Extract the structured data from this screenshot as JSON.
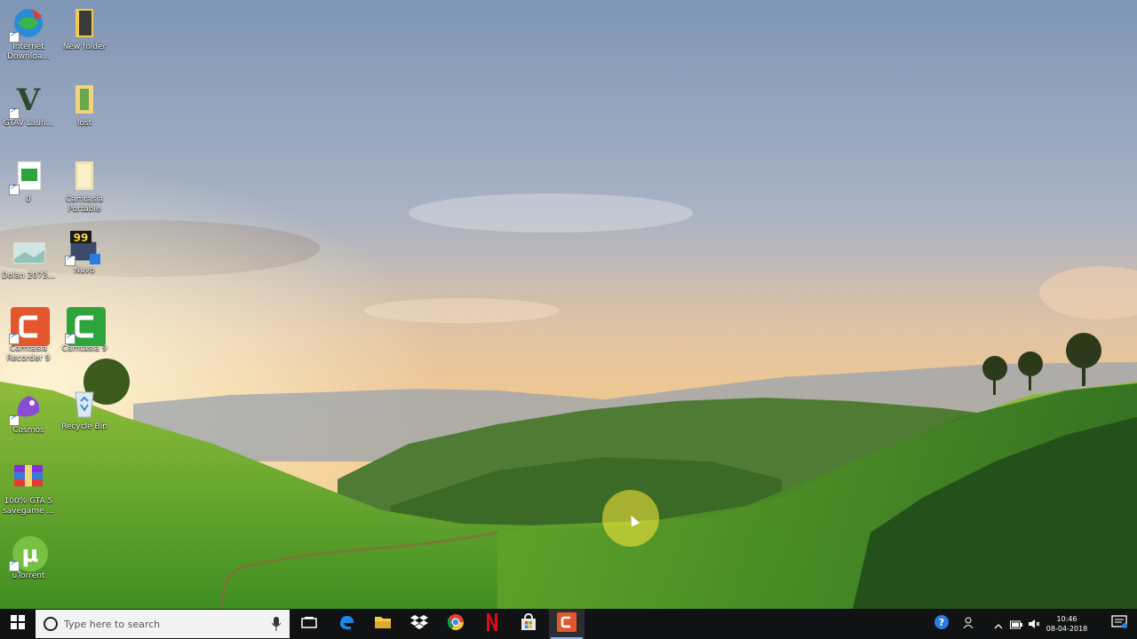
{
  "desktop": {
    "icons": [
      {
        "label": "Internet Downloa...",
        "icon": "idm-globe-icon"
      },
      {
        "label": "New folder",
        "icon": "folder-icon"
      },
      {
        "label": "GTAV Laun...",
        "icon": "gta-v-icon"
      },
      {
        "label": "lost",
        "icon": "folder-icon"
      },
      {
        "label": "0",
        "icon": "camtasia-file-icon"
      },
      {
        "label": "Camtasia Portable",
        "icon": "folder-icon"
      },
      {
        "label": "Dolan 2073...",
        "icon": "image-file-icon"
      },
      {
        "label": "Nuvo",
        "icon": "computer-99-icon"
      },
      {
        "label": "Camtasia Recorder 9",
        "icon": "camtasia-recorder-icon"
      },
      {
        "label": "Camtasia 9",
        "icon": "camtasia-icon"
      },
      {
        "label": "Cosmos",
        "icon": "purple-app-icon"
      },
      {
        "label": "Recycle Bin",
        "icon": "recycle-bin-icon"
      },
      {
        "label": "100% GTA 5 savegame ...",
        "icon": "winrar-archive-icon"
      },
      {
        "label": "uTorrent",
        "icon": "utorrent-icon"
      }
    ]
  },
  "taskbar": {
    "start_icon": "windows-start-icon",
    "search_placeholder": "Type here to search",
    "apps": [
      {
        "name": "task-view",
        "icon": "task-view-icon"
      },
      {
        "name": "edge",
        "icon": "edge-icon"
      },
      {
        "name": "file-explorer",
        "icon": "folder-icon"
      },
      {
        "name": "dropbox",
        "icon": "dropbox-icon"
      },
      {
        "name": "chrome",
        "icon": "chrome-icon"
      },
      {
        "name": "netflix",
        "icon": "netflix-icon"
      },
      {
        "name": "store",
        "icon": "store-icon"
      },
      {
        "name": "camtasia",
        "icon": "camtasia-recorder-icon"
      }
    ],
    "tray": {
      "time": "10:46",
      "date": "08-04-2018"
    }
  },
  "colors": {
    "taskbar_bg": "#101214",
    "camtasia_green": "#2ea43c",
    "camtasia_orange": "#e4572e",
    "accent": "#8ab4f8"
  }
}
